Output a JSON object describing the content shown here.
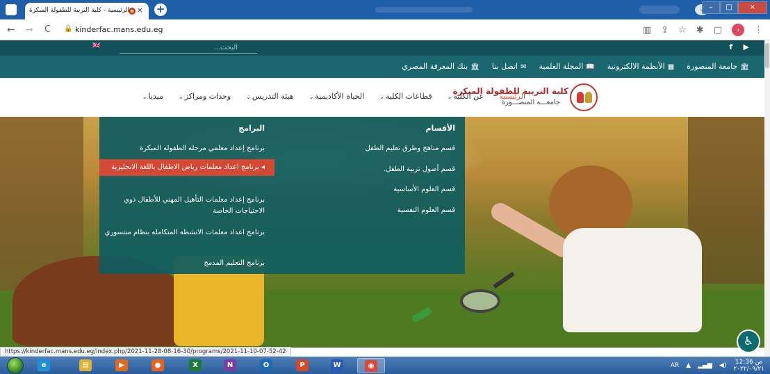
{
  "browser": {
    "tab_title": "الرئيسية - كلية التربية للطفولة المبكرة",
    "tab_close": "×",
    "new_tab": "+",
    "url": "kinderfac.mans.edu.eg",
    "back": "←",
    "forward": "→",
    "reload": "C",
    "lock": "🔒",
    "profile_initial": "د",
    "menu_dots": "⋮",
    "window_min": "–",
    "window_max": "□",
    "window_close": "×",
    "icons": [
      "translate-icon",
      "share-icon",
      "star-icon",
      "extensions-icon",
      "sidepanel-icon"
    ]
  },
  "site": {
    "topbar": {
      "flag": "🇬🇧",
      "search_placeholder": "البحث...",
      "social": [
        "f",
        "▶"
      ]
    },
    "links": [
      {
        "icon": "🏛",
        "label": "جامعة المنصورة"
      },
      {
        "icon": "▦",
        "label": "الأنظمة الالكترونية"
      },
      {
        "icon": "📖",
        "label": "المجلة العلمية"
      },
      {
        "icon": "✉",
        "label": "اتصل بنا"
      },
      {
        "icon": "🏛",
        "label": "بنك المعرفة المصري"
      }
    ],
    "brand": {
      "name": "كلية التربية للطفولة المبكرة",
      "university": "جامعـــة المنصـــورة"
    },
    "nav": [
      {
        "label": "الرئيسية",
        "chevron": ""
      },
      {
        "label": "عن الكلية",
        "chevron": "⌄"
      },
      {
        "label": "قطاعات الكلية",
        "chevron": "⌄"
      },
      {
        "label": "الحياة الأكاديمية",
        "chevron": "⌄"
      },
      {
        "label": "هيئة التدريس",
        "chevron": "⌄"
      },
      {
        "label": "وحدات ومراكز",
        "chevron": "⌄"
      },
      {
        "label": "ميديا",
        "chevron": "⌄"
      }
    ],
    "mega_menu": {
      "departments_title": "الأقسام",
      "departments": [
        "قسم مناهج وطرق تعليم الطفل",
        "قسم أصول تربية الطفل.",
        "قسم العلوم الأساسية",
        "قسم العلوم النفسية"
      ],
      "programs_title": "البرامج",
      "programs": [
        "برنامج إعداد معلمي مرحلة الطفولة المبكرة",
        "◂ برنامج اعداد معلمات رياض الاطفال باللغة الانجليزية",
        "برنامج إعداد معلمات التأهيل المهني للأطفال ذوي الاحتياجات الخاصة",
        "برنامج اعداد معلمات الانشطة المتكاملة بنظام منتسوري",
        "برنامج التعليم المدمج"
      ]
    },
    "accessibility_icon": "♿",
    "status_url": "https://kinderfac.mans.edu.eg/index.php/2021-11-28-08-16-30/programs/2021-11-10-07-52-42"
  },
  "taskbar": {
    "apps": [
      {
        "name": "ie-icon",
        "glyph": "e",
        "color": "#1e90d6"
      },
      {
        "name": "explorer-icon",
        "glyph": "▤",
        "color": "#e0b030"
      },
      {
        "name": "media-player-icon",
        "glyph": "▶",
        "color": "#e06a1e"
      },
      {
        "name": "firefox-icon",
        "glyph": "●",
        "color": "#e8641e"
      },
      {
        "name": "excel-icon",
        "glyph": "X",
        "color": "#1f7a3a"
      },
      {
        "name": "onenote-icon",
        "glyph": "N",
        "color": "#7a3fa0"
      },
      {
        "name": "outlook-icon",
        "glyph": "O",
        "color": "#1e6ab6"
      },
      {
        "name": "powerpoint-icon",
        "glyph": "P",
        "color": "#d24a2a"
      },
      {
        "name": "word-icon",
        "glyph": "W",
        "color": "#2a5ab6"
      },
      {
        "name": "chrome-icon",
        "glyph": "◉",
        "color": "#d84a3a"
      }
    ],
    "language": "AR",
    "time": "12:36 ص",
    "date": "٢٠٢٢/٠٩/٢١"
  }
}
